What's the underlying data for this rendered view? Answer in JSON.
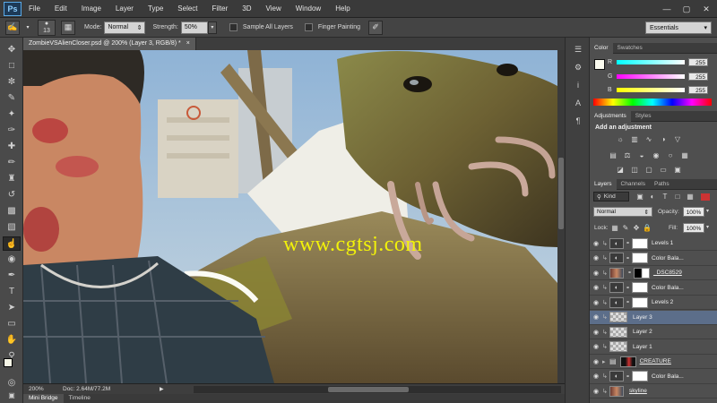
{
  "app": {
    "logo": "Ps"
  },
  "menu": [
    "File",
    "Edit",
    "Image",
    "Layer",
    "Type",
    "Select",
    "Filter",
    "3D",
    "View",
    "Window",
    "Help"
  ],
  "options": {
    "brush_size": "13",
    "mode_label": "Mode:",
    "mode_value": "Normal",
    "strength_label": "Strength:",
    "strength_value": "50%",
    "sample_all_layers": "Sample All Layers",
    "finger_painting": "Finger Painting",
    "workspace": "Essentials"
  },
  "document": {
    "tab_title": "ZombieVSAlienCloser.psd @ 200% (Layer 3, RGB/8) *",
    "watermark": "www.cgtsj.com",
    "zoom": "200%",
    "doc_info": "Doc: 2.64M/77.2M"
  },
  "bottom_tabs": [
    "Mini Bridge",
    "Timeline"
  ],
  "color_panel": {
    "tabs": [
      "Color",
      "Swatches"
    ],
    "channels": [
      {
        "name": "R",
        "value": "255"
      },
      {
        "name": "G",
        "value": "255"
      },
      {
        "name": "B",
        "value": "255"
      }
    ]
  },
  "adjustments_panel": {
    "tabs": [
      "Adjustments",
      "Styles"
    ],
    "title": "Add an adjustment"
  },
  "layers_panel": {
    "tabs": [
      "Layers",
      "Channels",
      "Paths"
    ],
    "filter": "Kind",
    "blend_mode": "Normal",
    "opacity_label": "Opacity:",
    "opacity_value": "100%",
    "lock_label": "Lock:",
    "fill_label": "Fill:",
    "fill_value": "100%",
    "layers": [
      {
        "name": "Levels 1",
        "kind": "adjustment",
        "selected": false
      },
      {
        "name": "Color Bala...",
        "kind": "adjustment",
        "selected": false
      },
      {
        "name": "_DSC8529",
        "kind": "image",
        "selected": false
      },
      {
        "name": "Color Bala...",
        "kind": "adjustment",
        "selected": false
      },
      {
        "name": "Levels 2",
        "kind": "adjustment",
        "selected": false
      },
      {
        "name": "Layer 3",
        "kind": "pixel",
        "selected": true
      },
      {
        "name": "Layer 2",
        "kind": "pixel",
        "selected": false
      },
      {
        "name": "Layer 1",
        "kind": "pixel",
        "selected": false
      },
      {
        "name": "CREATURE",
        "kind": "group",
        "selected": false
      },
      {
        "name": "Color Bala...",
        "kind": "adjustment",
        "selected": false
      },
      {
        "name": "skyline",
        "kind": "image",
        "selected": false
      }
    ]
  }
}
